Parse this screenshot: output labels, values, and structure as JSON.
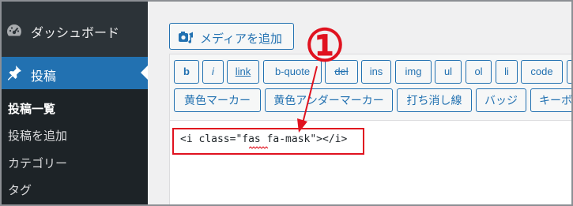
{
  "sidebar": {
    "dashboard_label": "ダッシュボード",
    "posts_label": "投稿",
    "submenu": [
      {
        "label": "投稿一覧",
        "current": true
      },
      {
        "label": "投稿を追加",
        "current": false
      },
      {
        "label": "カテゴリー",
        "current": false
      },
      {
        "label": "タグ",
        "current": false
      }
    ]
  },
  "editor": {
    "media_button_label": "メディアを追加",
    "quicktags_row1": [
      "b",
      "i",
      "link",
      "b-quote",
      "del",
      "ins",
      "img",
      "ul",
      "ol",
      "li",
      "code"
    ],
    "quicktags_row2": [
      "黄色マーカー",
      "黄色アンダーマーカー",
      "打ち消し線",
      "バッジ",
      "キーボ"
    ],
    "content": "<i class=\"fas fa-mask\"></i>"
  },
  "annotation": {
    "step_number": "①"
  },
  "colors": {
    "sidebar_bg": "#2c3338",
    "submenu_bg": "#1d2327",
    "active_menu_bg": "#2271b1",
    "button_text": "#2271b1",
    "annotation_red": "#e0121f"
  },
  "icons": {
    "dashboard": "dashboard-gauge-icon",
    "posts": "pushpin-icon",
    "media": "media-camera-icon"
  }
}
